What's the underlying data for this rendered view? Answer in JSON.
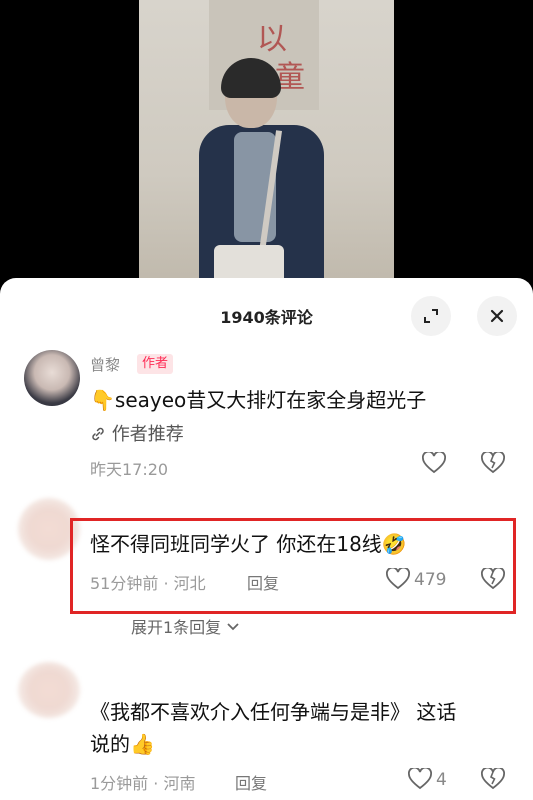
{
  "sheet": {
    "title": "1940条评论"
  },
  "comments": [
    {
      "username": "曾黎",
      "author_tag": "作者",
      "text": "👇seayeo昔又大排灯在家全身超光子",
      "pick_label": "作者推荐",
      "time": "昨天17:20"
    },
    {
      "username": "",
      "text": "怪不得同班同学火了 你还在18线🤣",
      "meta": "51分钟前 · 河北",
      "reply_label": "回复",
      "likes": "479",
      "expand_label": "展开1条回复"
    },
    {
      "username": "",
      "text_line1": "《我都不喜欢介入任何争端与是非》 这话",
      "text_line2": "说的👍",
      "meta": "1分钟前 · 河南",
      "reply_label": "回复",
      "likes": "4"
    }
  ],
  "colors": {
    "accent": "#fe2c55",
    "highlight": "#e02525"
  }
}
